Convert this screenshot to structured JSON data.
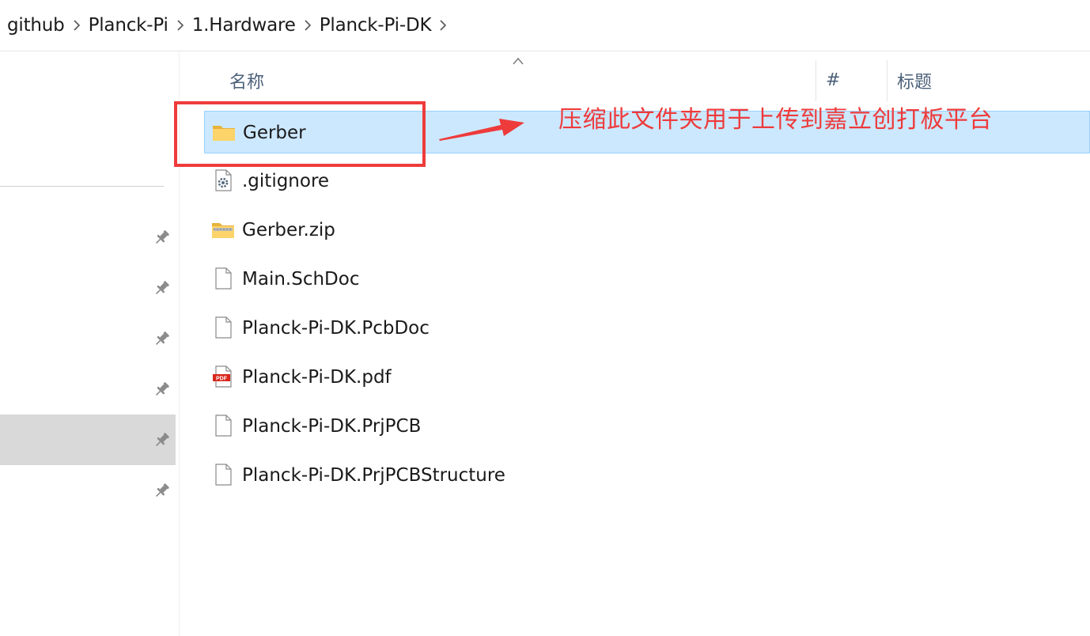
{
  "breadcrumb": [
    "github",
    "Planck-Pi",
    "1.Hardware",
    "Planck-Pi-DK"
  ],
  "columns": {
    "name": "名称",
    "number": "#",
    "title": "标题"
  },
  "files": [
    {
      "name": "Gerber",
      "icon": "folder-icon",
      "selected": true
    },
    {
      "name": ".gitignore",
      "icon": "settings-file-icon",
      "selected": false
    },
    {
      "name": "Gerber.zip",
      "icon": "zip-folder-icon",
      "selected": false
    },
    {
      "name": "Main.SchDoc",
      "icon": "file-icon",
      "selected": false
    },
    {
      "name": "Planck-Pi-DK.PcbDoc",
      "icon": "file-icon",
      "selected": false
    },
    {
      "name": "Planck-Pi-DK.pdf",
      "icon": "pdf-icon",
      "selected": false
    },
    {
      "name": "Planck-Pi-DK.PrjPCB",
      "icon": "file-icon",
      "selected": false
    },
    {
      "name": "Planck-Pi-DK.PrjPCBStructure",
      "icon": "file-icon",
      "selected": false
    }
  ],
  "annotation": {
    "text": "压缩此文件夹用于上传到嘉立创打板平台",
    "color": "#ee3b3b"
  },
  "colors": {
    "selection": "#cce8ff",
    "selection_border": "#99d1ff",
    "nav_selected": "#d9d9d9",
    "header_text": "#4c607a"
  }
}
